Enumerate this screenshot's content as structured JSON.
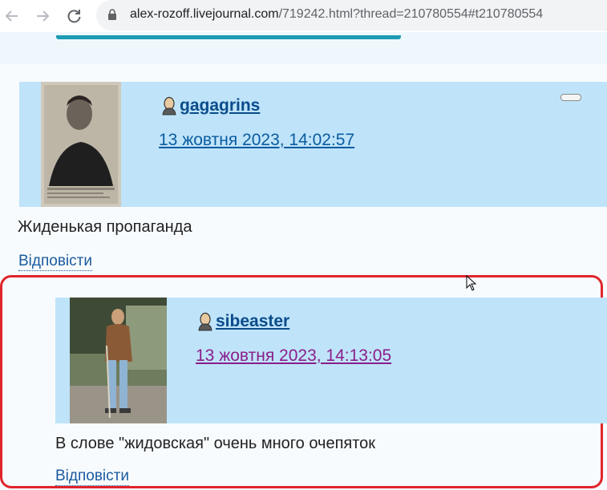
{
  "browser": {
    "url_host": "alex-rozoff.livejournal.com",
    "url_path": "/719242.html?thread=210780554#t210780554",
    "back_icon": "arrow-left-icon",
    "forward_icon": "arrow-right-icon",
    "reload_icon": "reload-icon"
  },
  "comments": [
    {
      "username": "gagagrins",
      "timestamp": "13 жовтня 2023, 14:02:57",
      "body": "Жиденькая пропаганда",
      "reply_label": "Відповісти"
    },
    {
      "username": "sibeaster",
      "timestamp": "13 жовтня 2023, 14:13:05",
      "body": "В слове \"жидовская\" очень много очепяток",
      "reply_label": "Відповісти"
    }
  ],
  "colors": {
    "header_bg": "#bfe4fa",
    "link": "#0a4c8a",
    "visited_link": "#8a1e8a",
    "highlight": "#e0252b"
  }
}
